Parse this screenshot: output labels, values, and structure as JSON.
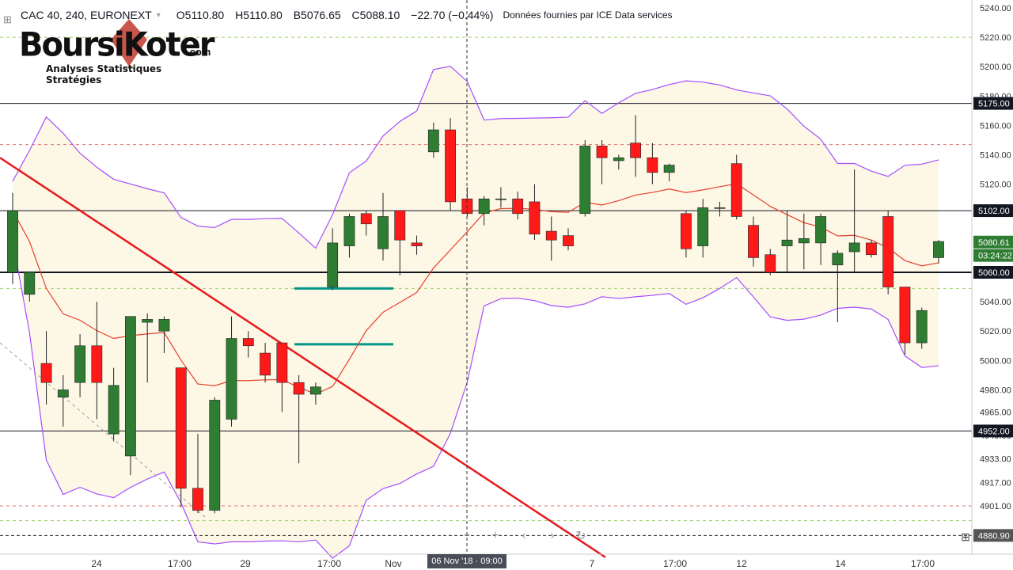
{
  "header": {
    "symbol": "CAC 40, 240, EURONEXT",
    "open": "O5110.80",
    "high": "H5110.80",
    "low": "B5076.65",
    "close": "C5088.10",
    "change": "−22.70 (−0.44%)",
    "data_source": "Données fournies par ICE Data services",
    "change_color": "#131722"
  },
  "logo": {
    "word": "BoursiKoter",
    "domain": ".com",
    "tagline": "Analyses Statistiques Stratégies"
  },
  "colors": {
    "bull": "#2e7d32",
    "bear": "#ff1a1a",
    "bollinger": "#a64dff",
    "ma": "#e8402e",
    "trendline": "#e8191c",
    "support": "#009688",
    "cloud": "#fdf6e3"
  },
  "price_axis": {
    "ticks": [
      "5240.00",
      "5220.00",
      "5200.00",
      "5180.00",
      "5160.00",
      "5140.00",
      "5120.00",
      "5100.00",
      "5080.00",
      "5060.00",
      "5040.00",
      "5020.00",
      "5000.00",
      "4980.00",
      "4965.00",
      "4949.00",
      "4933.00",
      "4917.00",
      "4901.00",
      "4880.00"
    ],
    "labels": [
      {
        "text": "5175.00",
        "price": 5175,
        "bg": "#131722"
      },
      {
        "text": "5102.00",
        "price": 5102,
        "bg": "#131722"
      },
      {
        "text": "5080.61",
        "price": 5080.61,
        "bg": "#2e7d32"
      },
      {
        "text": "03:24:22",
        "price": 5071.5,
        "bg": "#2e7d32"
      },
      {
        "text": "5060.00",
        "price": 5060,
        "bg": "#131722"
      },
      {
        "text": "4952.00",
        "price": 4952,
        "bg": "#131722"
      },
      {
        "text": "4880.90",
        "price": 4880.9,
        "bg": "#555555"
      }
    ]
  },
  "time_axis": {
    "labels": [
      "24",
      "17:00",
      "29",
      "17:00",
      "Nov",
      "7",
      "17:00",
      "12",
      "14",
      "17:00"
    ],
    "tooltip": "06 Nov '18 · 09:00"
  },
  "toolbar": [
    "zoom-out-icon",
    "zoom-in-icon",
    "scroll-left-icon",
    "scroll-right-icon",
    "reset-icon"
  ],
  "chart_data": {
    "type": "candlestick",
    "title": "",
    "ylim": [
      4870,
      5245
    ],
    "horizontal_levels": [
      5175,
      5102,
      5060,
      4952
    ],
    "dashed_levels": [
      5220,
      5147,
      5049,
      4901,
      4891
    ],
    "candles": [
      {
        "o": 5060,
        "h": 5114,
        "l": 5052,
        "c": 5102
      },
      {
        "o": 5045,
        "h": 5058,
        "l": 5040,
        "c": 5060
      },
      {
        "o": 4998,
        "h": 5020,
        "l": 4970,
        "c": 4985
      },
      {
        "o": 4975,
        "h": 4990,
        "l": 4955,
        "c": 4980
      },
      {
        "o": 4985,
        "h": 5018,
        "l": 4975,
        "c": 5010
      },
      {
        "o": 5010,
        "h": 5040,
        "l": 4960,
        "c": 4985
      },
      {
        "o": 4950,
        "h": 4995,
        "l": 4945,
        "c": 4983
      },
      {
        "o": 4935,
        "h": 5030,
        "l": 4922,
        "c": 5030
      },
      {
        "o": 5026,
        "h": 5032,
        "l": 4985,
        "c": 5028
      },
      {
        "o": 5020,
        "h": 5030,
        "l": 5005,
        "c": 5028
      },
      {
        "o": 4995,
        "h": 4995,
        "l": 4900,
        "c": 4913
      },
      {
        "o": 4913,
        "h": 4950,
        "l": 4896,
        "c": 4898
      },
      {
        "o": 4898,
        "h": 4975,
        "l": 4896,
        "c": 4973
      },
      {
        "o": 4960,
        "h": 5030,
        "l": 4955,
        "c": 5015
      },
      {
        "o": 5015,
        "h": 5020,
        "l": 5002,
        "c": 5010
      },
      {
        "o": 5005,
        "h": 5012,
        "l": 4985,
        "c": 4990
      },
      {
        "o": 5012,
        "h": 5012,
        "l": 4965,
        "c": 4985
      },
      {
        "o": 4985,
        "h": 4990,
        "l": 4930,
        "c": 4977
      },
      {
        "o": 4977,
        "h": 4985,
        "l": 4970,
        "c": 4982
      },
      {
        "o": 5050,
        "h": 5090,
        "l": 5048,
        "c": 5080
      },
      {
        "o": 5078,
        "h": 5100,
        "l": 5070,
        "c": 5098
      },
      {
        "o": 5100,
        "h": 5102,
        "l": 5085,
        "c": 5093
      },
      {
        "o": 5076,
        "h": 5114,
        "l": 5068,
        "c": 5098
      },
      {
        "o": 5102,
        "h": 5100,
        "l": 5058,
        "c": 5082
      },
      {
        "o": 5080,
        "h": 5085,
        "l": 5072,
        "c": 5078
      },
      {
        "o": 5142,
        "h": 5162,
        "l": 5138,
        "c": 5157
      },
      {
        "o": 5157,
        "h": 5165,
        "l": 5102,
        "c": 5108
      },
      {
        "o": 5110,
        "h": 5118,
        "l": 5098,
        "c": 5100
      },
      {
        "o": 5100,
        "h": 5112,
        "l": 5092,
        "c": 5110
      },
      {
        "o": 5110,
        "h": 5118,
        "l": 5104,
        "c": 5110
      },
      {
        "o": 5110,
        "h": 5115,
        "l": 5096,
        "c": 5100
      },
      {
        "o": 5108,
        "h": 5120,
        "l": 5082,
        "c": 5086
      },
      {
        "o": 5088,
        "h": 5098,
        "l": 5068,
        "c": 5082
      },
      {
        "o": 5085,
        "h": 5090,
        "l": 5075,
        "c": 5078
      },
      {
        "o": 5100,
        "h": 5150,
        "l": 5098,
        "c": 5146
      },
      {
        "o": 5146,
        "h": 5150,
        "l": 5120,
        "c": 5138
      },
      {
        "o": 5136,
        "h": 5140,
        "l": 5130,
        "c": 5138
      },
      {
        "o": 5148,
        "h": 5167,
        "l": 5125,
        "c": 5138
      },
      {
        "o": 5138,
        "h": 5148,
        "l": 5120,
        "c": 5128
      },
      {
        "o": 5128,
        "h": 5134,
        "l": 5122,
        "c": 5133
      },
      {
        "o": 5100,
        "h": 5102,
        "l": 5070,
        "c": 5076
      },
      {
        "o": 5078,
        "h": 5110,
        "l": 5070,
        "c": 5104
      },
      {
        "o": 5104,
        "h": 5108,
        "l": 5098,
        "c": 5104
      },
      {
        "o": 5134,
        "h": 5140,
        "l": 5096,
        "c": 5098
      },
      {
        "o": 5092,
        "h": 5098,
        "l": 5064,
        "c": 5070
      },
      {
        "o": 5072,
        "h": 5076,
        "l": 5058,
        "c": 5060
      },
      {
        "o": 5078,
        "h": 5102,
        "l": 5060,
        "c": 5082
      },
      {
        "o": 5080,
        "h": 5100,
        "l": 5062,
        "c": 5083
      },
      {
        "o": 5080,
        "h": 5100,
        "l": 5065,
        "c": 5098
      },
      {
        "o": 5065,
        "h": 5075,
        "l": 5026,
        "c": 5073
      },
      {
        "o": 5074,
        "h": 5130,
        "l": 5060,
        "c": 5080
      },
      {
        "o": 5080,
        "h": 5082,
        "l": 5070,
        "c": 5072
      },
      {
        "o": 5098,
        "h": 5102,
        "l": 5045,
        "c": 5050
      },
      {
        "o": 5050,
        "h": 5050,
        "l": 5004,
        "c": 5012
      },
      {
        "o": 5012,
        "h": 5036,
        "l": 5008,
        "c": 5034
      },
      {
        "o": 5070,
        "h": 5082,
        "l": 5066,
        "c": 5081
      }
    ]
  }
}
